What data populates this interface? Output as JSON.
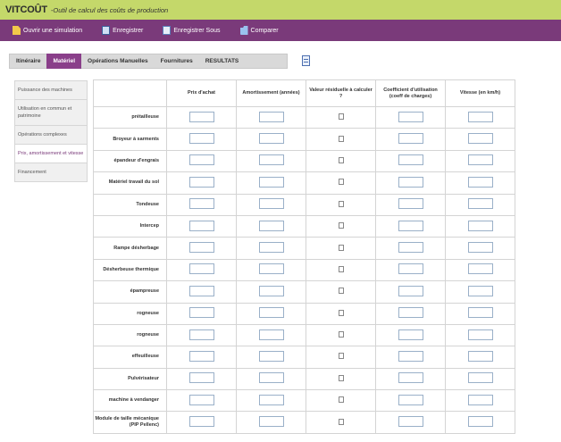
{
  "title": {
    "app": "VITCOÛT",
    "subtitle": "-Outil de calcul des coûts de production"
  },
  "toolbar": [
    {
      "label": "Ouvrir une simulation",
      "icon": "file-icon"
    },
    {
      "label": "Enregistrer",
      "icon": "save-icon"
    },
    {
      "label": "Enregistrer Sous",
      "icon": "save-as-icon"
    },
    {
      "label": "Comparer",
      "icon": "compare-icon"
    }
  ],
  "tabs": [
    {
      "label": "Itinéraire",
      "active": false
    },
    {
      "label": "Matériel",
      "active": true
    },
    {
      "label": "Opérations Manuelles",
      "active": false
    },
    {
      "label": "Fournitures",
      "active": false
    },
    {
      "label": "RESULTATS",
      "active": false
    }
  ],
  "sidebar": [
    {
      "label": "Puissance des machines",
      "active": false
    },
    {
      "label": "Utilisation en commun et patrimoine",
      "active": false
    },
    {
      "label": "Opérations complexes",
      "active": false
    },
    {
      "label": "Prix, amortissement et vitesse",
      "active": true
    },
    {
      "label": "Financement",
      "active": false
    }
  ],
  "columns": [
    "",
    "Prix d'achat",
    "Amortissement (années)",
    "Valeur résiduelle à calculer ?",
    "Coefficient d'utilisation (coeff de charges)",
    "Vitesse (en km/h)"
  ],
  "rows": [
    "prétailleuse",
    "Broyeur à sarments",
    "épandeur d'engrais",
    "Matériel travail du sol",
    "Tondeuse",
    "Intercep",
    "Rampe désherbage",
    "Désherbeuse thermique",
    "épampreuse",
    "rogneuse",
    "rogneuse",
    "effeuilleuse",
    "Pulvérisateur",
    "machine à vendanger",
    "Module de taille mécanique (PIP Pellenc)"
  ]
}
